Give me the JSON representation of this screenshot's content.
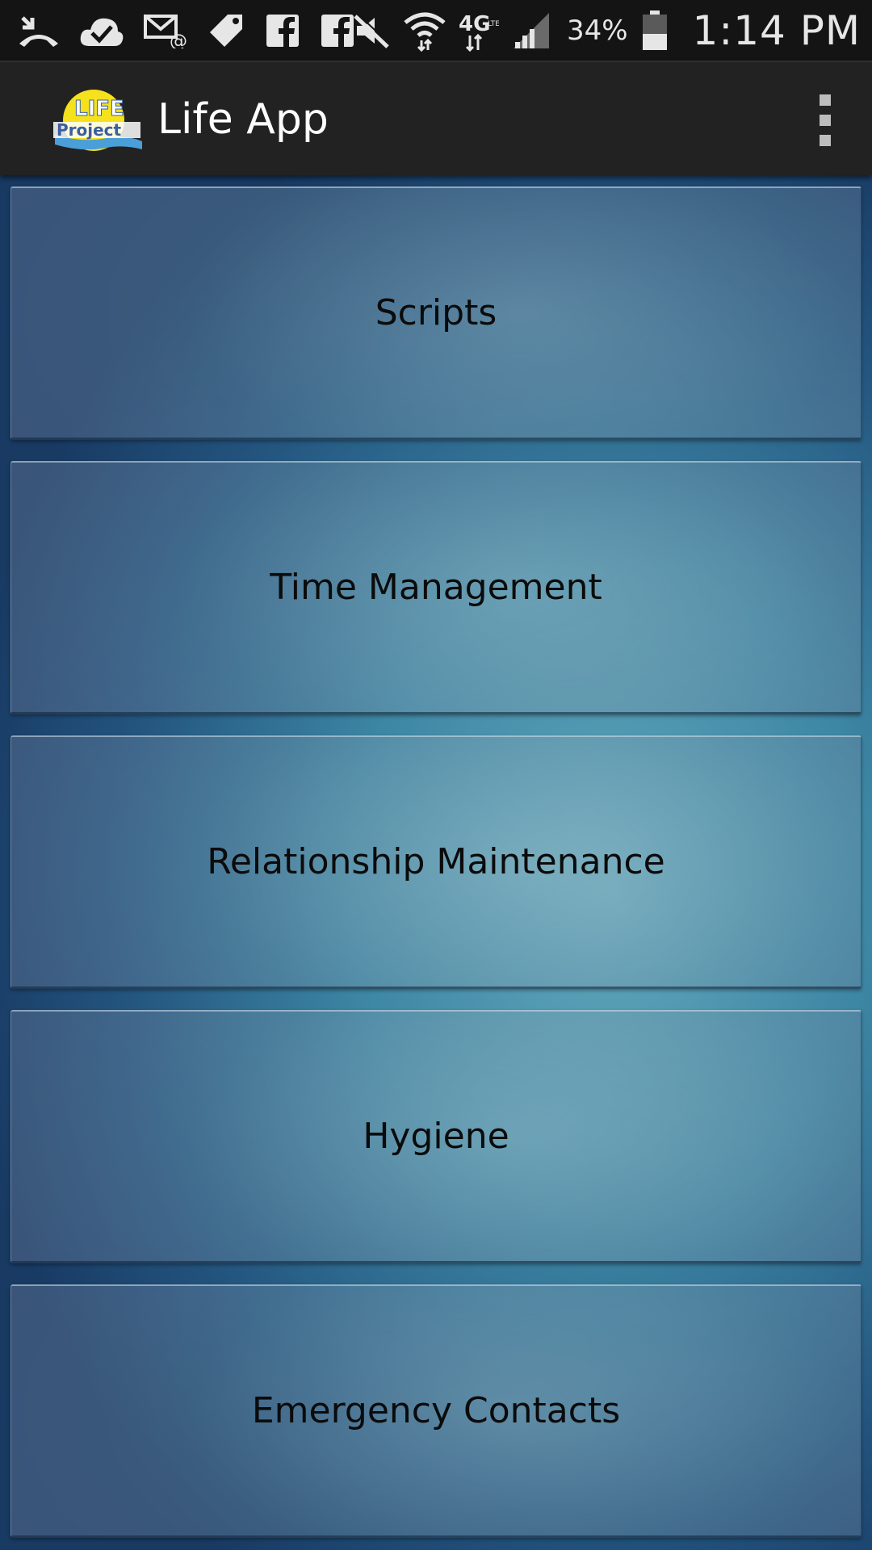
{
  "status_bar": {
    "left_icons": [
      "missed-call-icon",
      "cloud-check-icon",
      "email-icon",
      "tag-icon",
      "facebook-icon",
      "facebook-icon"
    ],
    "right_icons": [
      "mute-icon",
      "wifi-icon",
      "4g-lte-icon",
      "signal-icon",
      "battery-icon"
    ],
    "battery": "34%",
    "time": "1:14 PM"
  },
  "action_bar": {
    "logo_icon": "life-project-logo",
    "title": "Life App",
    "overflow_icon": "more-vertical-icon"
  },
  "menu": {
    "buttons": [
      {
        "label": "Scripts"
      },
      {
        "label": "Time Management"
      },
      {
        "label": "Relationship Maintenance"
      },
      {
        "label": "Hygiene"
      },
      {
        "label": "Emergency Contacts"
      }
    ]
  },
  "colors": {
    "status_bar_bg": "#141414",
    "action_bar_bg": "#222222",
    "content_bg_center": "#63a9bd",
    "content_bg_edge": "#183a63",
    "button_text": "#0b0b0b"
  }
}
